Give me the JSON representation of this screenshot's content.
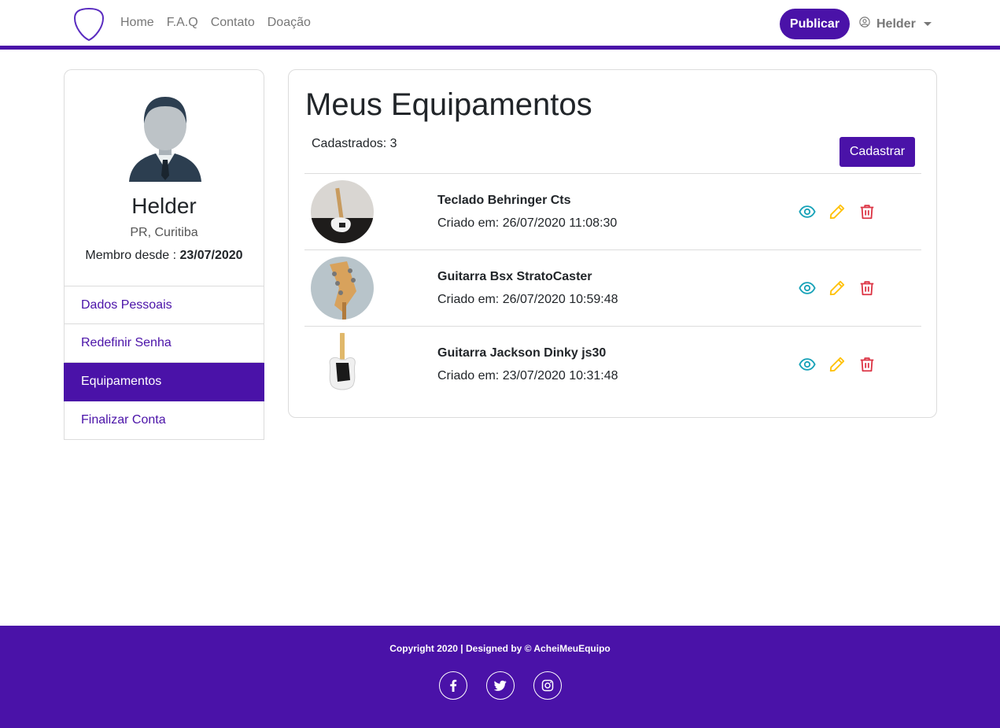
{
  "navbar": {
    "links": [
      "Home",
      "F.A.Q",
      "Contato",
      "Doação"
    ],
    "publish_label": "Publicar",
    "user_name": "Helder"
  },
  "profile": {
    "name": "Helder",
    "location": "PR, Curitiba",
    "member_since_label": "Membro desde : ",
    "member_since_date": "23/07/2020"
  },
  "side_menu": {
    "items": [
      {
        "label": "Dados Pessoais",
        "active": false
      },
      {
        "label": "Redefinir Senha",
        "active": false
      },
      {
        "label": "Equipamentos",
        "active": true
      },
      {
        "label": "Finalizar Conta",
        "active": false
      }
    ]
  },
  "main": {
    "title": "Meus Equipamentos",
    "count_label": "Cadastrados: 3",
    "register_label": "Cadastrar",
    "equipments": [
      {
        "name": "Teclado Behringer Cts",
        "date": "Criado em: 26/07/2020 11:08:30"
      },
      {
        "name": "Guitarra Bsx StratoCaster",
        "date": "Criado em: 26/07/2020 10:59:48"
      },
      {
        "name": "Guitarra Jackson Dinky js30",
        "date": "Criado em: 23/07/2020 10:31:48"
      }
    ]
  },
  "footer": {
    "copyright": "Copyright 2020 | Designed by © AcheiMeuEquipo",
    "socials": [
      "facebook-icon",
      "twitter-icon",
      "instagram-icon"
    ]
  },
  "colors": {
    "brand": "#4a12a8",
    "view": "#17a2b8",
    "edit": "#ffc107",
    "delete": "#dc3545"
  }
}
